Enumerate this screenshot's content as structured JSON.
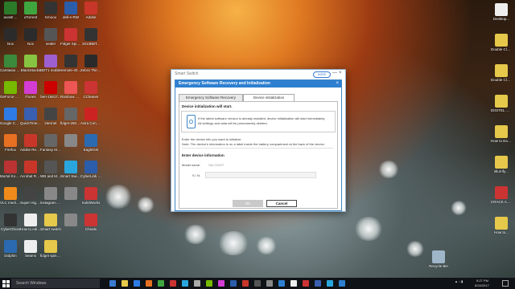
{
  "desktop_icons": [
    {
      "label": "avast! ...\nprosepris Sil...",
      "color": "#2a7a2a"
    },
    {
      "label": "uTorrent",
      "color": "#3fa63f"
    },
    {
      "label": "Kmoox",
      "color": "#333"
    },
    {
      "label": "dell-e-RW",
      "color": "#2b5dab"
    },
    {
      "label": "Adobe",
      "color": "#c8362a"
    },
    {
      "label": "Nox",
      "color": "#2b2b2b"
    },
    {
      "label": "Nox",
      "color": "#2b2b2b"
    },
    {
      "label": "sealer",
      "color": "#555"
    },
    {
      "label": "Fidget Spinner",
      "color": "#c33"
    },
    {
      "label": "2013BBT...",
      "color": "#333"
    },
    {
      "label": "Camtasia Studio 8",
      "color": "#3b8a3b"
    },
    {
      "label": "BlackStacks",
      "color": "#86c441"
    },
    {
      "label": "BDT1 mobile",
      "color": "#9e5fd0"
    },
    {
      "label": "remote-40...",
      "color": "#333"
    },
    {
      "label": "Zebra The Animal...",
      "color": "#2a2a2a"
    },
    {
      "label": "GeForce Experience",
      "color": "#76b900"
    },
    {
      "label": "iTunes",
      "color": "#d33dd3"
    },
    {
      "label": "ben-16617...",
      "color": "#c00"
    },
    {
      "label": "Rainbow Fidget...",
      "color": "#e55"
    },
    {
      "label": "CCleaner",
      "color": "#c33"
    },
    {
      "label": "Google Chrome",
      "color": "#2e7be6"
    },
    {
      "label": "QuickTime Player",
      "color": "#3a5fb0"
    },
    {
      "label": "internet",
      "color": "#444"
    },
    {
      "label": "fidget-2506...",
      "color": "#666"
    },
    {
      "label": "Avira Connect",
      "color": "#c22"
    },
    {
      "label": "Firefox",
      "color": "#e77022"
    },
    {
      "label": "Adobe Reader...",
      "color": "#c8362a"
    },
    {
      "label": "Fantasy Mobile...",
      "color": "#666"
    },
    {
      "label": "",
      "color": "#888"
    },
    {
      "label": "EagleGet",
      "color": "#2b6ab0"
    },
    {
      "label": "Mortal Kombat X",
      "color": "#b33"
    },
    {
      "label": "Acrobat Reader DC",
      "color": "#c8362a"
    },
    {
      "label": "WB and Mobile...",
      "color": "#555"
    },
    {
      "label": "Smart Switch",
      "color": "#2aa6de"
    },
    {
      "label": "CyberLink YouCam 5",
      "color": "#2b5dab"
    },
    {
      "label": "VLC media player",
      "color": "#f08a1a"
    },
    {
      "label": "Super High...",
      "color": "#444"
    },
    {
      "label": "instagram fidget...",
      "color": "#888"
    },
    {
      "label": "",
      "color": "#888"
    },
    {
      "label": "SolidWorks",
      "color": "#c33"
    },
    {
      "label": "CyberGhost",
      "color": "#333"
    },
    {
      "label": "How to edit...",
      "color": "#eee"
    },
    {
      "label": "Smart switch",
      "color": "#e6c84a"
    },
    {
      "label": "",
      "color": "#888"
    },
    {
      "label": "Cheats",
      "color": "#c33"
    },
    {
      "label": "Dolphin",
      "color": "#2b6ab0"
    },
    {
      "label": "Seams",
      "color": "#eee"
    },
    {
      "label": "fidget spinner",
      "color": "#e6c84a"
    },
    {
      "label": "Recycle Bin",
      "color": "#9fb6c9"
    }
  ],
  "right_icons": [
    {
      "label": "Desktop...\nSuper-s...",
      "color": "#eee"
    },
    {
      "label": "Double Clean Master Boos...",
      "color": "#e6c84a"
    },
    {
      "label": "Double Clean Master Boo...",
      "color": "#e6c84a"
    },
    {
      "label": "DIGITEL ST Plus Andro...",
      "color": "#e6c84a"
    },
    {
      "label": "How to Easily install a To...",
      "color": "#e6c84a"
    },
    {
      "label": "Blurrify...",
      "color": "#e6c84a"
    },
    {
      "label": "CRACK Any Android...",
      "color": "#c33"
    },
    {
      "label": "How to...\nAndroid...",
      "color": "#e6c84a"
    }
  ],
  "window": {
    "app_title": "Smart Switch",
    "pill_label": "MORE",
    "ctl_min": "—",
    "ctl_close": "×",
    "inner_title": "Emergency Software Recovery and Initialization",
    "inner_close": "×",
    "tabs": [
      "Emergency Software Recovery",
      "Device initialization"
    ],
    "active_tab": 1,
    "heading": "Device initialization will start.",
    "info_line1": "If the latest software version is already installed, device initialization will start immediately.",
    "info_line2": "All settings and data will be permanently deleted.",
    "enter_text": "Enter the device info you want to initialize.",
    "note_text": "Note: The device's information is on a label inside the battery compartment at the back of the device.",
    "section": "Enter device information",
    "model_label": "Model name:",
    "model_value": "SM-G920T",
    "sn_label": "S / N:",
    "sn_value": "",
    "ok": "OK",
    "cancel": "Cancel"
  },
  "taskbar": {
    "search_placeholder": "Search Windows",
    "time": "5:27 PM",
    "date": "6/24/2017"
  }
}
